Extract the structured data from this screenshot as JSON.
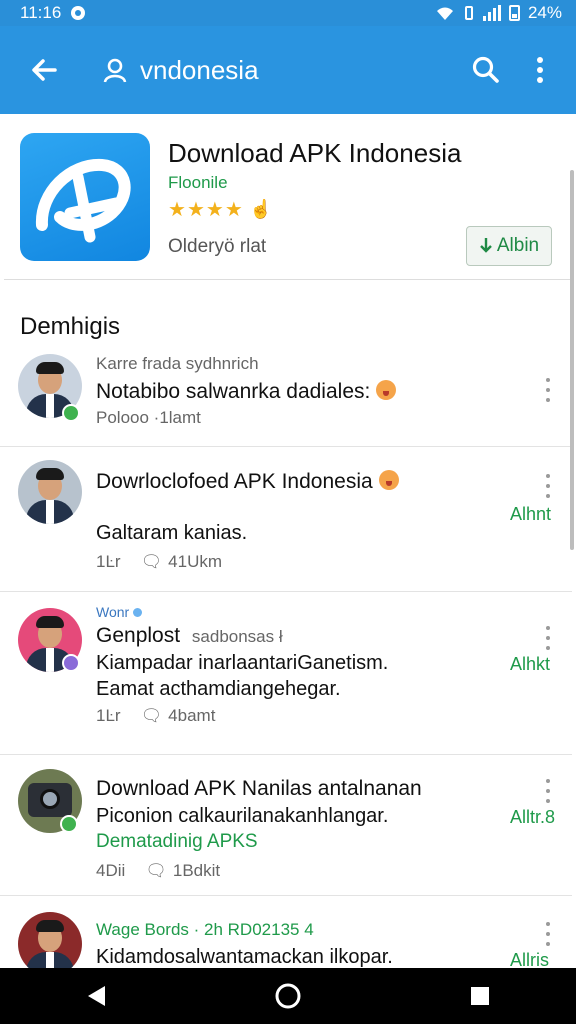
{
  "status": {
    "time": "11:16",
    "battery": "24%"
  },
  "colors": {
    "primary": "#2a94e0",
    "green": "#1f9a4a",
    "star": "#f3b11c"
  },
  "toolbar": {
    "query": "vndonesia",
    "icons": [
      "back-arrow-icon",
      "user-icon",
      "search-icon",
      "overflow-icon"
    ]
  },
  "app": {
    "title": "Download APK Indonesia",
    "developer": "Floonile",
    "rating_stars": 4,
    "subtitle": "Olderyö rlat",
    "install_label": "Albin"
  },
  "section": {
    "title": "Demhigis"
  },
  "items": [
    {
      "header": "Karre frada sydhnrich",
      "title": "Notabibo salwanrka dadiales:",
      "meta": "Polooo ·1lamt",
      "action": ""
    },
    {
      "header": "",
      "title": "Dowrloclofoed APK Indonesia",
      "body": "Galtaram kanias.",
      "meta_likes": "1Ŀr",
      "meta_comments": "41Ukm",
      "action": "Alhnt"
    },
    {
      "header": "Wonr",
      "title": "Genplost",
      "title_suffix": "sadbonsas ł",
      "body_line1": "Kiampadar inarlaantariGanetism.",
      "body_line2": "Eamat acthamdiangehegar.",
      "meta_likes": "1Ŀr",
      "meta_comments": "4bamt",
      "action": "Alhkt"
    },
    {
      "title": "Download APK Nanilas antalnanan",
      "body_line1": "Piconion calkaurilanakanhlangar.",
      "body_line2": "Dematadinig APKS",
      "meta_likes": "4Dii",
      "meta_comments": "1Bdkit",
      "action": "Alltr.8"
    },
    {
      "header": "Wage Bords · 2h RD02135 4",
      "title": "Kidamdosalwantamackan ilkopar.",
      "action": "Allris"
    }
  ]
}
